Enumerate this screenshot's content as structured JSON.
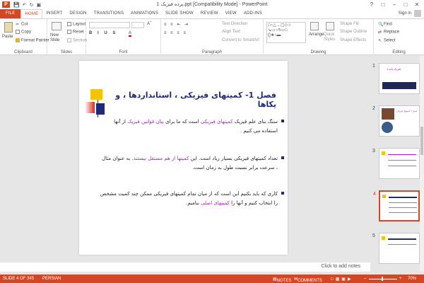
{
  "window": {
    "title": "پرده فیزیک 1.ppt [Compatibility Mode] - PowerPoint"
  },
  "tabs": [
    "FILE",
    "HOME",
    "INSERT",
    "DESIGN",
    "TRANSITIONS",
    "ANIMATIONS",
    "SLIDE SHOW",
    "REVIEW",
    "VIEW",
    "ADD-INS"
  ],
  "signin": "Sign in",
  "ribbon": {
    "clipboard": {
      "label": "Clipboard",
      "paste": "Paste",
      "cut": "Cut",
      "copy": "Copy",
      "format_painter": "Format Painter"
    },
    "slides": {
      "label": "Slides",
      "new_slide": "New Slide",
      "layout": "Layout",
      "reset": "Reset",
      "section": "Section"
    },
    "font": {
      "label": "Font"
    },
    "paragraph": {
      "label": "Paragraph",
      "text_direction": "Text Direction",
      "align_text": "Align Text",
      "convert": "Convert to SmartArt"
    },
    "drawing": {
      "label": "Drawing",
      "arrange": "Arrange",
      "quick_styles": "Quick Styles",
      "shape_fill": "Shape Fill",
      "shape_outline": "Shape Outline",
      "shape_effects": "Shape Effects"
    },
    "editing": {
      "label": "Editing",
      "find": "Find",
      "replace": "Replace",
      "select": "Select"
    }
  },
  "slide": {
    "title": "فصل 1- کمیتهای فیزیکی ، استانداردها ، و یکاها",
    "p1": {
      "a": "سنگ بنای علم فیزیک ",
      "b": "کمیتهای فیزیکی",
      "c": " است که ما برای ",
      "d": "بیان قوانین فیزیک",
      "e": " از آنها استفاده می کنیم ."
    },
    "p2": {
      "a": "تعداد کمیتهای فیزیکی بسیار زیاد است. این ",
      "b": "کمیتها از هم مستقل نیستند.",
      "c": " به عنوان مثال ، سرعت برابر نسبت طول به زمان است."
    },
    "p3": {
      "a": "کاری که باید بکنیم این است که از میان تمام کمیتهای فیزیکی ممکن چند کمیت  مشخص را انتخاب کنیم و آنها را ",
      "b": "کمیتهای اصلی",
      "c": " بنامیم."
    }
  },
  "thumbnails": [
    {
      "num": "1",
      "caption": "فیزیک پایه 1"
    },
    {
      "num": "2",
      "caption": "فصل 1 کمیتهای فیزیکی"
    },
    {
      "num": "3",
      "caption": ""
    },
    {
      "num": "4",
      "caption": ""
    },
    {
      "num": "5",
      "caption": ""
    }
  ],
  "notes_placeholder": "Click to add notes",
  "status": {
    "slide": "SLIDE 4 OF 345",
    "language": "PERSIAN",
    "notes": "NOTES",
    "comments": "COMMENTS",
    "zoom": "70%"
  },
  "colors": {
    "accent": "#d24726",
    "title": "#1f2a7a",
    "highlight": "#b01cc7"
  }
}
